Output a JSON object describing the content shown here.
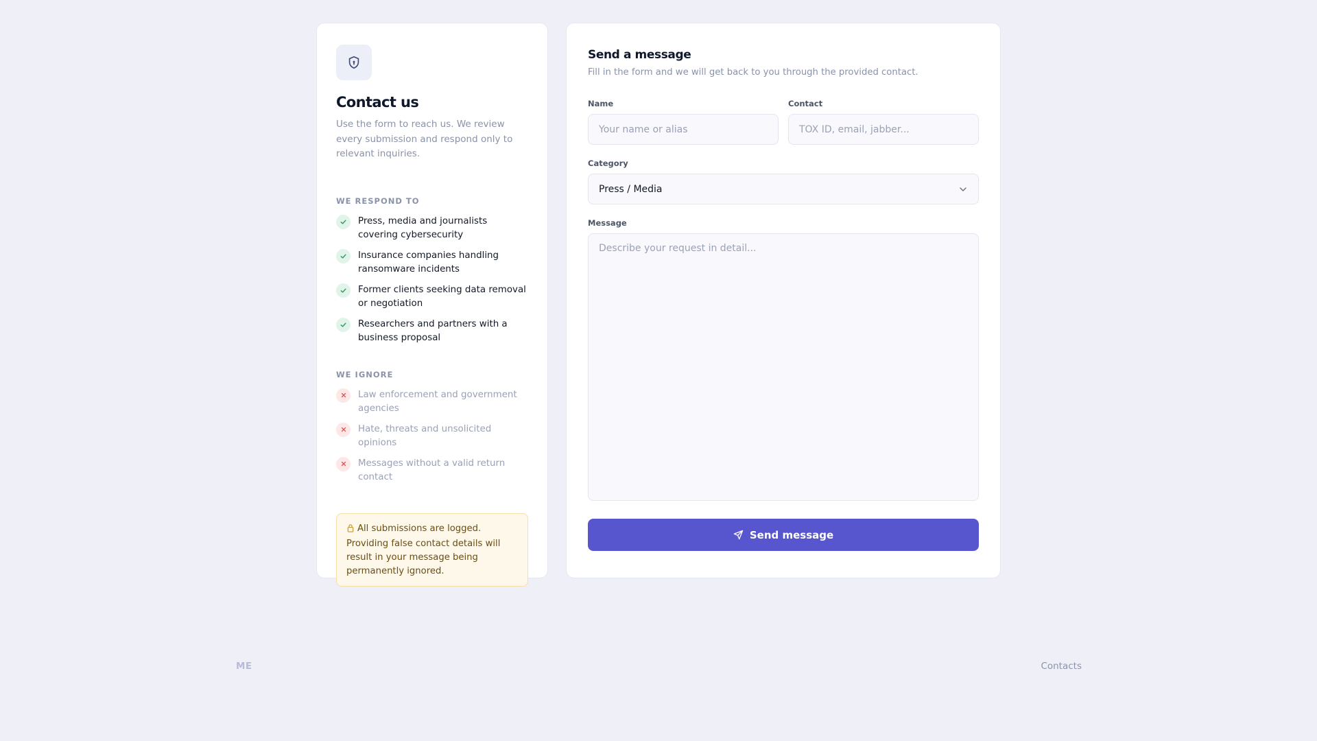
{
  "info": {
    "title": "Contact us",
    "description": "Use the form to reach us. We review every submission and respond only to relevant inquiries.",
    "respond_heading": "WE RESPOND TO",
    "respond_items": [
      "Press, media and journalists covering cybersecurity",
      "Insurance companies handling ransomware incidents",
      "Former clients seeking data removal or negotiation",
      "Researchers and partners with a business proposal"
    ],
    "ignore_heading": "WE IGNORE",
    "ignore_items": [
      "Law enforcement and government agencies",
      "Hate, threats and unsolicited opinions",
      "Messages without a valid return contact"
    ],
    "notice": "All submissions are logged. Providing false contact details will result in your message being permanently ignored."
  },
  "form": {
    "title": "Send a message",
    "subtitle": "Fill in the form and we will get back to you through the provided contact.",
    "name_label": "Name",
    "name_placeholder": "Your name or alias",
    "contact_label": "Contact",
    "contact_placeholder": "TOX ID, email, jabber...",
    "category_label": "Category",
    "category_value": "Press / Media",
    "message_label": "Message",
    "message_placeholder": "Describe your request in detail...",
    "submit_label": "Send message"
  },
  "footer": {
    "brand": "ME",
    "contacts_link": "Contacts"
  },
  "icons": {
    "header": "shield-keyhole-icon",
    "respond": "check-icon",
    "ignore": "x-icon",
    "notice": "lock-icon",
    "submit": "send-icon",
    "select": "chevron-down-icon"
  },
  "colors": {
    "accent": "#5756ce",
    "check": "#2f9e63",
    "cross": "#e05252",
    "notice_bg": "#fdf8ea",
    "notice_text": "#6b4d10"
  }
}
